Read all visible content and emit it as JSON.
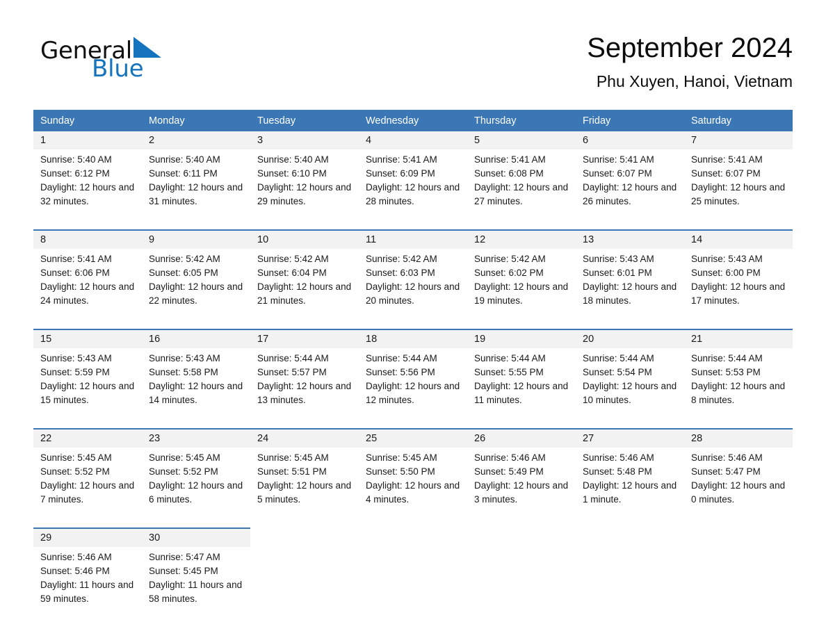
{
  "brand": {
    "name_part1": "General",
    "name_part2": "Blue",
    "triangle_color": "#1574bd",
    "logo_icon": "general-blue-logo"
  },
  "header": {
    "title": "September 2024",
    "subtitle": "Phu Xuyen, Hanoi, Vietnam"
  },
  "theme": {
    "header_blue": "#3b77b5",
    "daynum_bg": "#f2f2f2",
    "brand_blue": "#1574bd",
    "text": "#1a1a1a"
  },
  "weekday_headers": [
    "Sunday",
    "Monday",
    "Tuesday",
    "Wednesday",
    "Thursday",
    "Friday",
    "Saturday"
  ],
  "weeks": [
    {
      "days": [
        {
          "date": "1",
          "sunrise": "Sunrise: 5:40 AM",
          "sunset": "Sunset: 6:12 PM",
          "daylight": "Daylight: 12 hours and 32 minutes."
        },
        {
          "date": "2",
          "sunrise": "Sunrise: 5:40 AM",
          "sunset": "Sunset: 6:11 PM",
          "daylight": "Daylight: 12 hours and 31 minutes."
        },
        {
          "date": "3",
          "sunrise": "Sunrise: 5:40 AM",
          "sunset": "Sunset: 6:10 PM",
          "daylight": "Daylight: 12 hours and 29 minutes."
        },
        {
          "date": "4",
          "sunrise": "Sunrise: 5:41 AM",
          "sunset": "Sunset: 6:09 PM",
          "daylight": "Daylight: 12 hours and 28 minutes."
        },
        {
          "date": "5",
          "sunrise": "Sunrise: 5:41 AM",
          "sunset": "Sunset: 6:08 PM",
          "daylight": "Daylight: 12 hours and 27 minutes."
        },
        {
          "date": "6",
          "sunrise": "Sunrise: 5:41 AM",
          "sunset": "Sunset: 6:07 PM",
          "daylight": "Daylight: 12 hours and 26 minutes."
        },
        {
          "date": "7",
          "sunrise": "Sunrise: 5:41 AM",
          "sunset": "Sunset: 6:07 PM",
          "daylight": "Daylight: 12 hours and 25 minutes."
        }
      ]
    },
    {
      "days": [
        {
          "date": "8",
          "sunrise": "Sunrise: 5:41 AM",
          "sunset": "Sunset: 6:06 PM",
          "daylight": "Daylight: 12 hours and 24 minutes."
        },
        {
          "date": "9",
          "sunrise": "Sunrise: 5:42 AM",
          "sunset": "Sunset: 6:05 PM",
          "daylight": "Daylight: 12 hours and 22 minutes."
        },
        {
          "date": "10",
          "sunrise": "Sunrise: 5:42 AM",
          "sunset": "Sunset: 6:04 PM",
          "daylight": "Daylight: 12 hours and 21 minutes."
        },
        {
          "date": "11",
          "sunrise": "Sunrise: 5:42 AM",
          "sunset": "Sunset: 6:03 PM",
          "daylight": "Daylight: 12 hours and 20 minutes."
        },
        {
          "date": "12",
          "sunrise": "Sunrise: 5:42 AM",
          "sunset": "Sunset: 6:02 PM",
          "daylight": "Daylight: 12 hours and 19 minutes."
        },
        {
          "date": "13",
          "sunrise": "Sunrise: 5:43 AM",
          "sunset": "Sunset: 6:01 PM",
          "daylight": "Daylight: 12 hours and 18 minutes."
        },
        {
          "date": "14",
          "sunrise": "Sunrise: 5:43 AM",
          "sunset": "Sunset: 6:00 PM",
          "daylight": "Daylight: 12 hours and 17 minutes."
        }
      ]
    },
    {
      "days": [
        {
          "date": "15",
          "sunrise": "Sunrise: 5:43 AM",
          "sunset": "Sunset: 5:59 PM",
          "daylight": "Daylight: 12 hours and 15 minutes."
        },
        {
          "date": "16",
          "sunrise": "Sunrise: 5:43 AM",
          "sunset": "Sunset: 5:58 PM",
          "daylight": "Daylight: 12 hours and 14 minutes."
        },
        {
          "date": "17",
          "sunrise": "Sunrise: 5:44 AM",
          "sunset": "Sunset: 5:57 PM",
          "daylight": "Daylight: 12 hours and 13 minutes."
        },
        {
          "date": "18",
          "sunrise": "Sunrise: 5:44 AM",
          "sunset": "Sunset: 5:56 PM",
          "daylight": "Daylight: 12 hours and 12 minutes."
        },
        {
          "date": "19",
          "sunrise": "Sunrise: 5:44 AM",
          "sunset": "Sunset: 5:55 PM",
          "daylight": "Daylight: 12 hours and 11 minutes."
        },
        {
          "date": "20",
          "sunrise": "Sunrise: 5:44 AM",
          "sunset": "Sunset: 5:54 PM",
          "daylight": "Daylight: 12 hours and 10 minutes."
        },
        {
          "date": "21",
          "sunrise": "Sunrise: 5:44 AM",
          "sunset": "Sunset: 5:53 PM",
          "daylight": "Daylight: 12 hours and 8 minutes."
        }
      ]
    },
    {
      "days": [
        {
          "date": "22",
          "sunrise": "Sunrise: 5:45 AM",
          "sunset": "Sunset: 5:52 PM",
          "daylight": "Daylight: 12 hours and 7 minutes."
        },
        {
          "date": "23",
          "sunrise": "Sunrise: 5:45 AM",
          "sunset": "Sunset: 5:52 PM",
          "daylight": "Daylight: 12 hours and 6 minutes."
        },
        {
          "date": "24",
          "sunrise": "Sunrise: 5:45 AM",
          "sunset": "Sunset: 5:51 PM",
          "daylight": "Daylight: 12 hours and 5 minutes."
        },
        {
          "date": "25",
          "sunrise": "Sunrise: 5:45 AM",
          "sunset": "Sunset: 5:50 PM",
          "daylight": "Daylight: 12 hours and 4 minutes."
        },
        {
          "date": "26",
          "sunrise": "Sunrise: 5:46 AM",
          "sunset": "Sunset: 5:49 PM",
          "daylight": "Daylight: 12 hours and 3 minutes."
        },
        {
          "date": "27",
          "sunrise": "Sunrise: 5:46 AM",
          "sunset": "Sunset: 5:48 PM",
          "daylight": "Daylight: 12 hours and 1 minute."
        },
        {
          "date": "28",
          "sunrise": "Sunrise: 5:46 AM",
          "sunset": "Sunset: 5:47 PM",
          "daylight": "Daylight: 12 hours and 0 minutes."
        }
      ]
    },
    {
      "days": [
        {
          "date": "29",
          "sunrise": "Sunrise: 5:46 AM",
          "sunset": "Sunset: 5:46 PM",
          "daylight": "Daylight: 11 hours and 59 minutes."
        },
        {
          "date": "30",
          "sunrise": "Sunrise: 5:47 AM",
          "sunset": "Sunset: 5:45 PM",
          "daylight": "Daylight: 11 hours and 58 minutes."
        },
        {
          "date": "",
          "sunrise": "",
          "sunset": "",
          "daylight": ""
        },
        {
          "date": "",
          "sunrise": "",
          "sunset": "",
          "daylight": ""
        },
        {
          "date": "",
          "sunrise": "",
          "sunset": "",
          "daylight": ""
        },
        {
          "date": "",
          "sunrise": "",
          "sunset": "",
          "daylight": ""
        },
        {
          "date": "",
          "sunrise": "",
          "sunset": "",
          "daylight": ""
        }
      ]
    }
  ]
}
